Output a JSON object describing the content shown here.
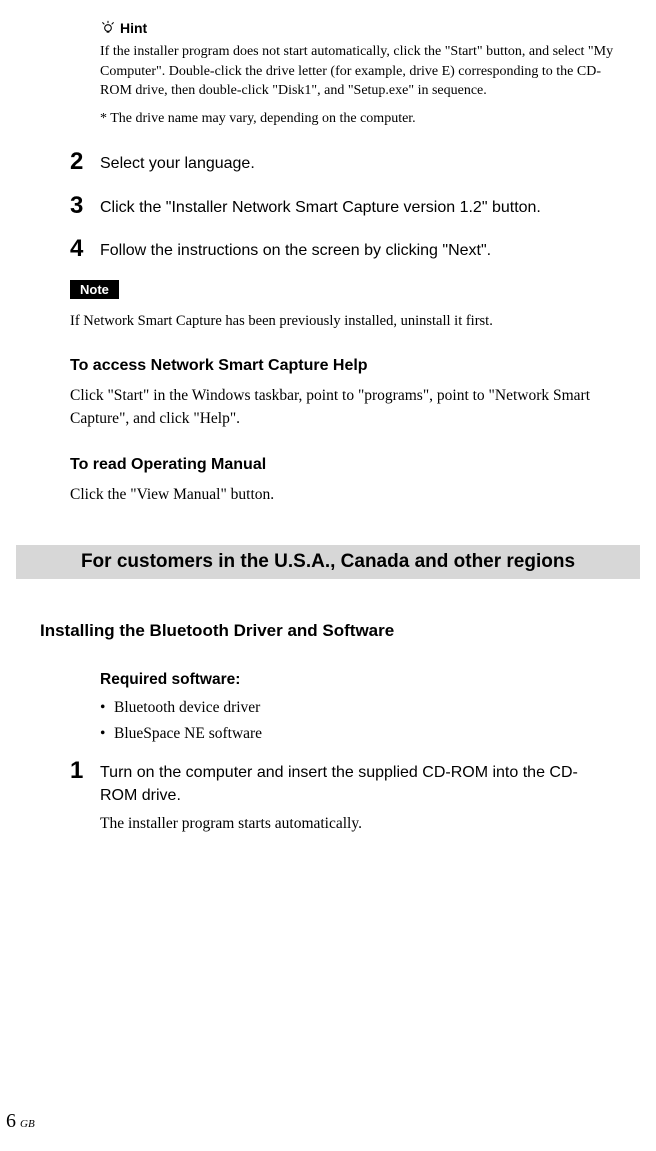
{
  "hint": {
    "label": "Hint",
    "body": "If the installer program does not start automatically, click the \"Start\" button, and select \"My Computer\". Double-click the drive letter (for example, drive E) corresponding to the CD-ROM drive, then double-click \"Disk1\", and \"Setup.exe\" in sequence.",
    "footnote": "* The drive name may vary, depending on the computer."
  },
  "steps_top": [
    {
      "n": "2",
      "text": "Select your language."
    },
    {
      "n": "3",
      "text": "Click the \"Installer Network Smart Capture version 1.2\" button."
    },
    {
      "n": "4",
      "text": "Follow the instructions on the screen by clicking \"Next\"."
    }
  ],
  "note": {
    "label": "Note",
    "body": "If Network Smart Capture has been previously installed, uninstall it first."
  },
  "access": {
    "heading": "To access Network Smart Capture Help",
    "body": "Click \"Start\" in the Windows taskbar, point to \"programs\", point to \"Network Smart Capture\", and click \"Help\"."
  },
  "manual": {
    "heading": "To read Operating Manual",
    "body": "Click the \"View Manual\" button."
  },
  "section_bar": "For customers in the U.S.A., Canada and other regions",
  "bt": {
    "heading": "Installing the Bluetooth Driver and Software",
    "required_heading": "Required software:",
    "bullets": [
      "Bluetooth device driver",
      "BlueSpace NE software"
    ],
    "step1": {
      "n": "1",
      "text": "Turn on the computer and insert the supplied CD-ROM into the CD-ROM drive.",
      "sub": "The installer program starts automatically."
    }
  },
  "footer": {
    "page": "6",
    "region": "GB"
  }
}
